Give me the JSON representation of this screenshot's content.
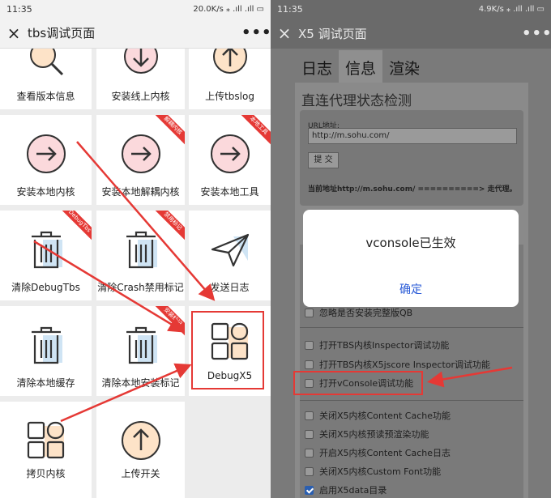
{
  "left": {
    "status": {
      "time": "11:35",
      "stat": "20.0K/s ⁎ .ıll .ıll ▭"
    },
    "nav": {
      "close": "×",
      "title": "tbs调试页面",
      "more": "•••"
    },
    "grid": [
      {
        "label": "查看版本信息",
        "icon": "magnifier-icon",
        "ribbon": ""
      },
      {
        "label": "安装线上内核",
        "icon": "download-arrow-icon",
        "ribbon": ""
      },
      {
        "label": "上传tbslog",
        "icon": "upload-arrow-icon",
        "ribbon": ""
      },
      {
        "label": "安装本地内核",
        "icon": "right-arrow-icon",
        "ribbon": ""
      },
      {
        "label": "安装本地解耦内核",
        "icon": "right-arrow-icon",
        "ribbon": "解耦内核"
      },
      {
        "label": "安装本地工具",
        "icon": "right-arrow-icon",
        "ribbon": "本地工具"
      },
      {
        "label": "清除DebugTbs",
        "icon": "trash-icon",
        "ribbon": "DebugTbs"
      },
      {
        "label": "清除Crash禁用标记",
        "icon": "trash-icon",
        "ribbon": "禁用标记"
      },
      {
        "label": "发送日志",
        "icon": "paper-plane-icon",
        "ribbon": ""
      },
      {
        "label": "清除本地缓存",
        "icon": "trash-icon",
        "ribbon": ""
      },
      {
        "label": "清除本地安装标记",
        "icon": "trash-icon",
        "ribbon": "安装标记"
      },
      {
        "label": "DebugX5",
        "icon": "grid-squares-icon",
        "ribbon": ""
      },
      {
        "label": "拷贝内核",
        "icon": "grid-squares-icon",
        "ribbon": ""
      },
      {
        "label": "上传开关",
        "icon": "upload-arrow-icon",
        "ribbon": ""
      }
    ]
  },
  "right": {
    "status": {
      "time": "11:35",
      "stat": "4.9K/s ⁎ .ıll .ıll ▭"
    },
    "nav": {
      "close": "×",
      "title": "X5 调试页面",
      "more": "•••"
    },
    "tabs": [
      {
        "label": "日志",
        "active": false
      },
      {
        "label": "信息",
        "active": true
      },
      {
        "label": "渲染",
        "active": false
      }
    ],
    "section_title": "直连代理状态检测",
    "url_label": "URL地址:",
    "url_value": "http://m.sohu.com/",
    "submit_label": "提 交",
    "proxy_status": "当前地址http://m.sohu.com/ ==========> 走代理。",
    "options": [
      {
        "label": "忽略是否安装完整版QB",
        "checked": false
      },
      {
        "label": "打开TBS内核Inspector调试功能",
        "checked": false
      },
      {
        "label": "打开TBS内核X5jscore Inspector调试功能",
        "checked": false
      },
      {
        "label": "打开vConsole调试功能",
        "checked": false
      },
      {
        "label": "关闭X5内核Content Cache功能",
        "checked": false
      },
      {
        "label": "关闭X5内核预读预渲染功能",
        "checked": false
      },
      {
        "label": "开启X5内核Content Cache日志",
        "checked": false
      },
      {
        "label": "关闭X5内核Custom Font功能",
        "checked": false
      },
      {
        "label": "启用X5data目录",
        "checked": true
      }
    ],
    "dialog": {
      "message": "vconsole已生效",
      "confirm": "确定"
    }
  },
  "colors": {
    "accent_red": "#e53935",
    "dialog_link": "#2a5bd7",
    "check_blue": "#2b5fb0"
  }
}
